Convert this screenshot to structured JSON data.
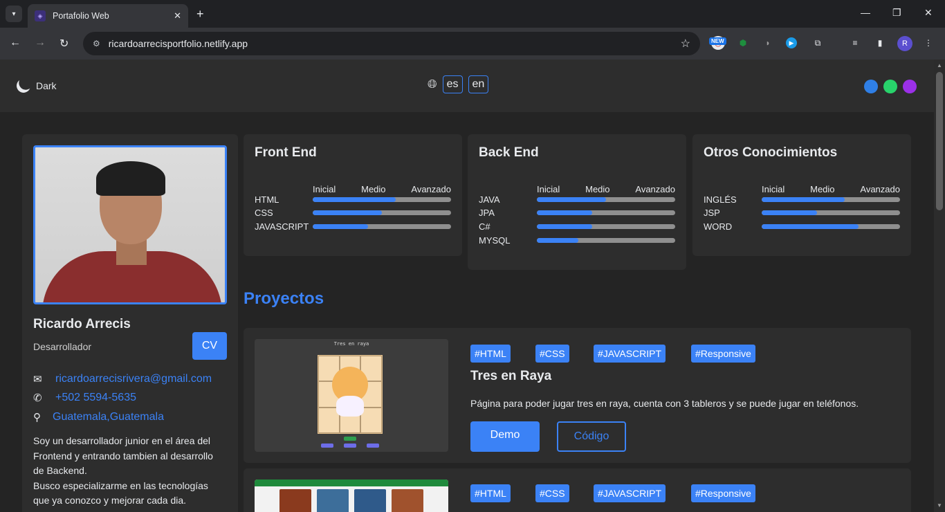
{
  "browser": {
    "tab_title": "Portafolio Web",
    "url": "ricardoarrecisportfolio.netlify.app",
    "new_badge": "NEW",
    "profile_initial": "R"
  },
  "nav": {
    "theme_label": "Dark",
    "languages": [
      "es",
      "en"
    ],
    "color_options": [
      "#2f7fe6",
      "#28d36b",
      "#9b30e8"
    ]
  },
  "profile": {
    "name": "Ricardo Arrecis",
    "role": "Desarrollador",
    "cv_label": "CV",
    "email": "ricardoarrecisrivera@gmail.com",
    "phone": "+502 5594-5635",
    "location": "Guatemala,Guatemala",
    "bio_lines": [
      "Soy un desarrollador junior en el área del",
      "Frontend y entrando tambien al desarrollo",
      "de Backend.",
      "Busco especializarme en las tecnologías",
      "que ya conozco y mejorar cada dia."
    ]
  },
  "skills": {
    "levels": [
      "Inicial",
      "Medio",
      "Avanzado"
    ],
    "groups": [
      {
        "title": "Front End",
        "items": [
          {
            "name": "HTML",
            "level": 0.6
          },
          {
            "name": "CSS",
            "level": 0.5
          },
          {
            "name": "JAVASCRIPT",
            "level": 0.4
          }
        ]
      },
      {
        "title": "Back End",
        "items": [
          {
            "name": "JAVA",
            "level": 0.5
          },
          {
            "name": "JPA",
            "level": 0.4
          },
          {
            "name": "C#",
            "level": 0.4
          },
          {
            "name": "MYSQL",
            "level": 0.3
          }
        ]
      },
      {
        "title": "Otros Conocimientos",
        "items": [
          {
            "name": "INGLÉS",
            "level": 0.6
          },
          {
            "name": "JSP",
            "level": 0.4
          },
          {
            "name": "WORD",
            "level": 0.7
          }
        ]
      }
    ]
  },
  "projects": {
    "heading": "Proyectos",
    "items": [
      {
        "tags": [
          "#HTML",
          "#CSS",
          "#JAVASCRIPT",
          "#Responsive"
        ],
        "title": "Tres en Raya",
        "description": "Página para poder jugar tres en raya, cuenta con 3 tableros y se puede jugar en teléfonos.",
        "thumb_title": "Tres en raya",
        "demo_label": "Demo",
        "code_label": "Código"
      },
      {
        "tags": [
          "#HTML",
          "#CSS",
          "#JAVASCRIPT",
          "#Responsive"
        ]
      }
    ]
  }
}
